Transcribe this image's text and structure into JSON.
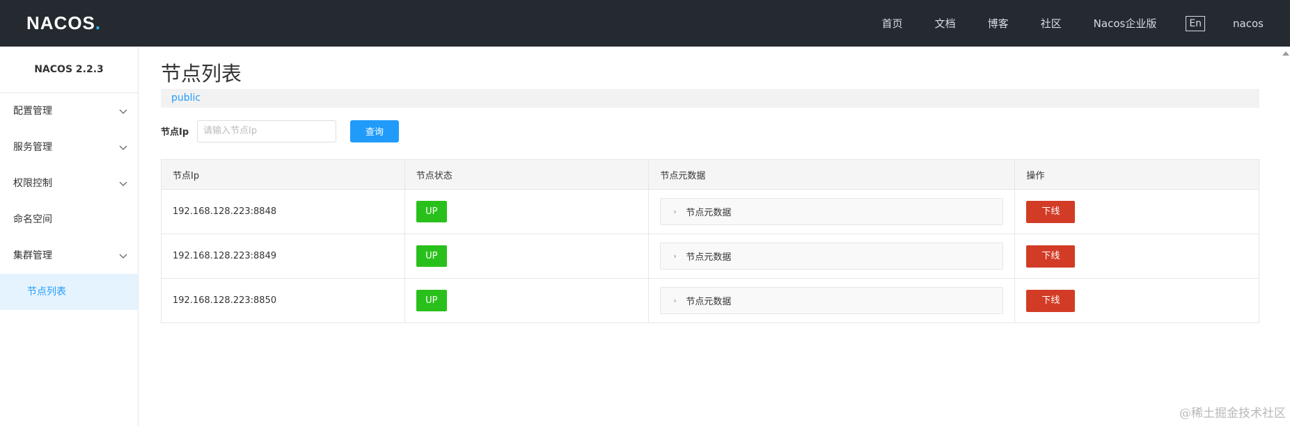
{
  "header": {
    "logo_text": "NACOS",
    "logo_dot": ".",
    "nav": [
      "首页",
      "文档",
      "博客",
      "社区",
      "Nacos企业版"
    ],
    "lang": "En",
    "user": "nacos"
  },
  "sidebar": {
    "version": "NACOS 2.2.3",
    "items": [
      {
        "label": "配置管理"
      },
      {
        "label": "服务管理"
      },
      {
        "label": "权限控制"
      },
      {
        "label": "命名空间"
      },
      {
        "label": "集群管理"
      }
    ],
    "sub_item": "节点列表"
  },
  "main": {
    "title": "节点列表",
    "namespace": "public",
    "filter": {
      "label": "节点Ip",
      "placeholder": "请输入节点Ip",
      "value": "",
      "button": "查询"
    },
    "table": {
      "headers": [
        "节点Ip",
        "节点状态",
        "节点元数据",
        "操作"
      ],
      "rows": [
        {
          "ip": "192.168.128.223:8848",
          "status": "UP",
          "meta": "节点元数据",
          "action": "下线"
        },
        {
          "ip": "192.168.128.223:8849",
          "status": "UP",
          "meta": "节点元数据",
          "action": "下线"
        },
        {
          "ip": "192.168.128.223:8850",
          "status": "UP",
          "meta": "节点元数据",
          "action": "下线"
        }
      ]
    }
  },
  "watermark": "@稀土掘金技术社区",
  "colors": {
    "header_bg": "#252a30",
    "accent": "#209bfa",
    "status_up": "#2ac01c",
    "danger": "#d23c26"
  }
}
